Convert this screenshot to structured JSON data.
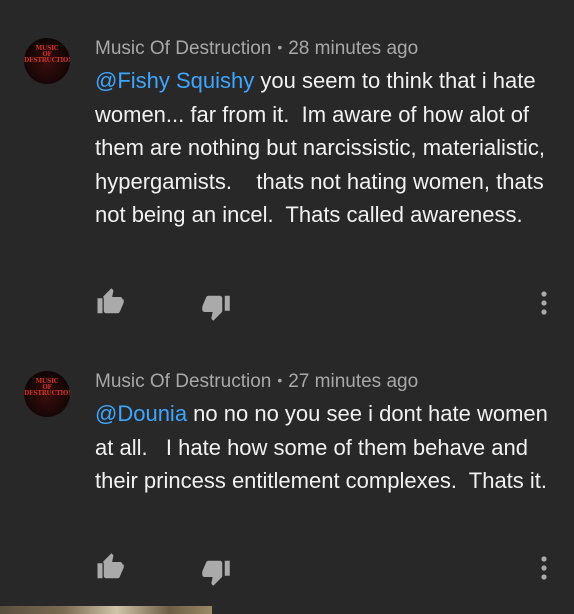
{
  "comments": [
    {
      "avatar_text": "MUSIC\nOF\nDESTRUCTION",
      "author": "Music Of Destruction",
      "separator": "•",
      "time": "28 minutes ago",
      "mention": "@Fishy Squishy",
      "text": " you seem to think that i hate women... far from it.  Im aware of how alot of them are nothing but narcissistic, materialistic, hypergamists.    thats not hating women, thats not being an incel.  Thats called awareness."
    },
    {
      "avatar_text": "MUSIC\nOF\nDESTRUCTION",
      "author": "Music Of Destruction",
      "separator": "•",
      "time": "27 minutes ago",
      "mention": "@Dounia",
      "text": " no no no you see i dont hate women at all.   I hate how some of them behave and their princess entitlement complexes.  Thats it."
    }
  ],
  "icons": {
    "like": "thumbs-up-icon",
    "dislike": "thumbs-down-icon",
    "more": "more-vertical-icon"
  },
  "colors": {
    "background": "#282828",
    "mention": "#3ea6ff",
    "text": "#f1f1f1",
    "meta": "#a8a8a8"
  }
}
